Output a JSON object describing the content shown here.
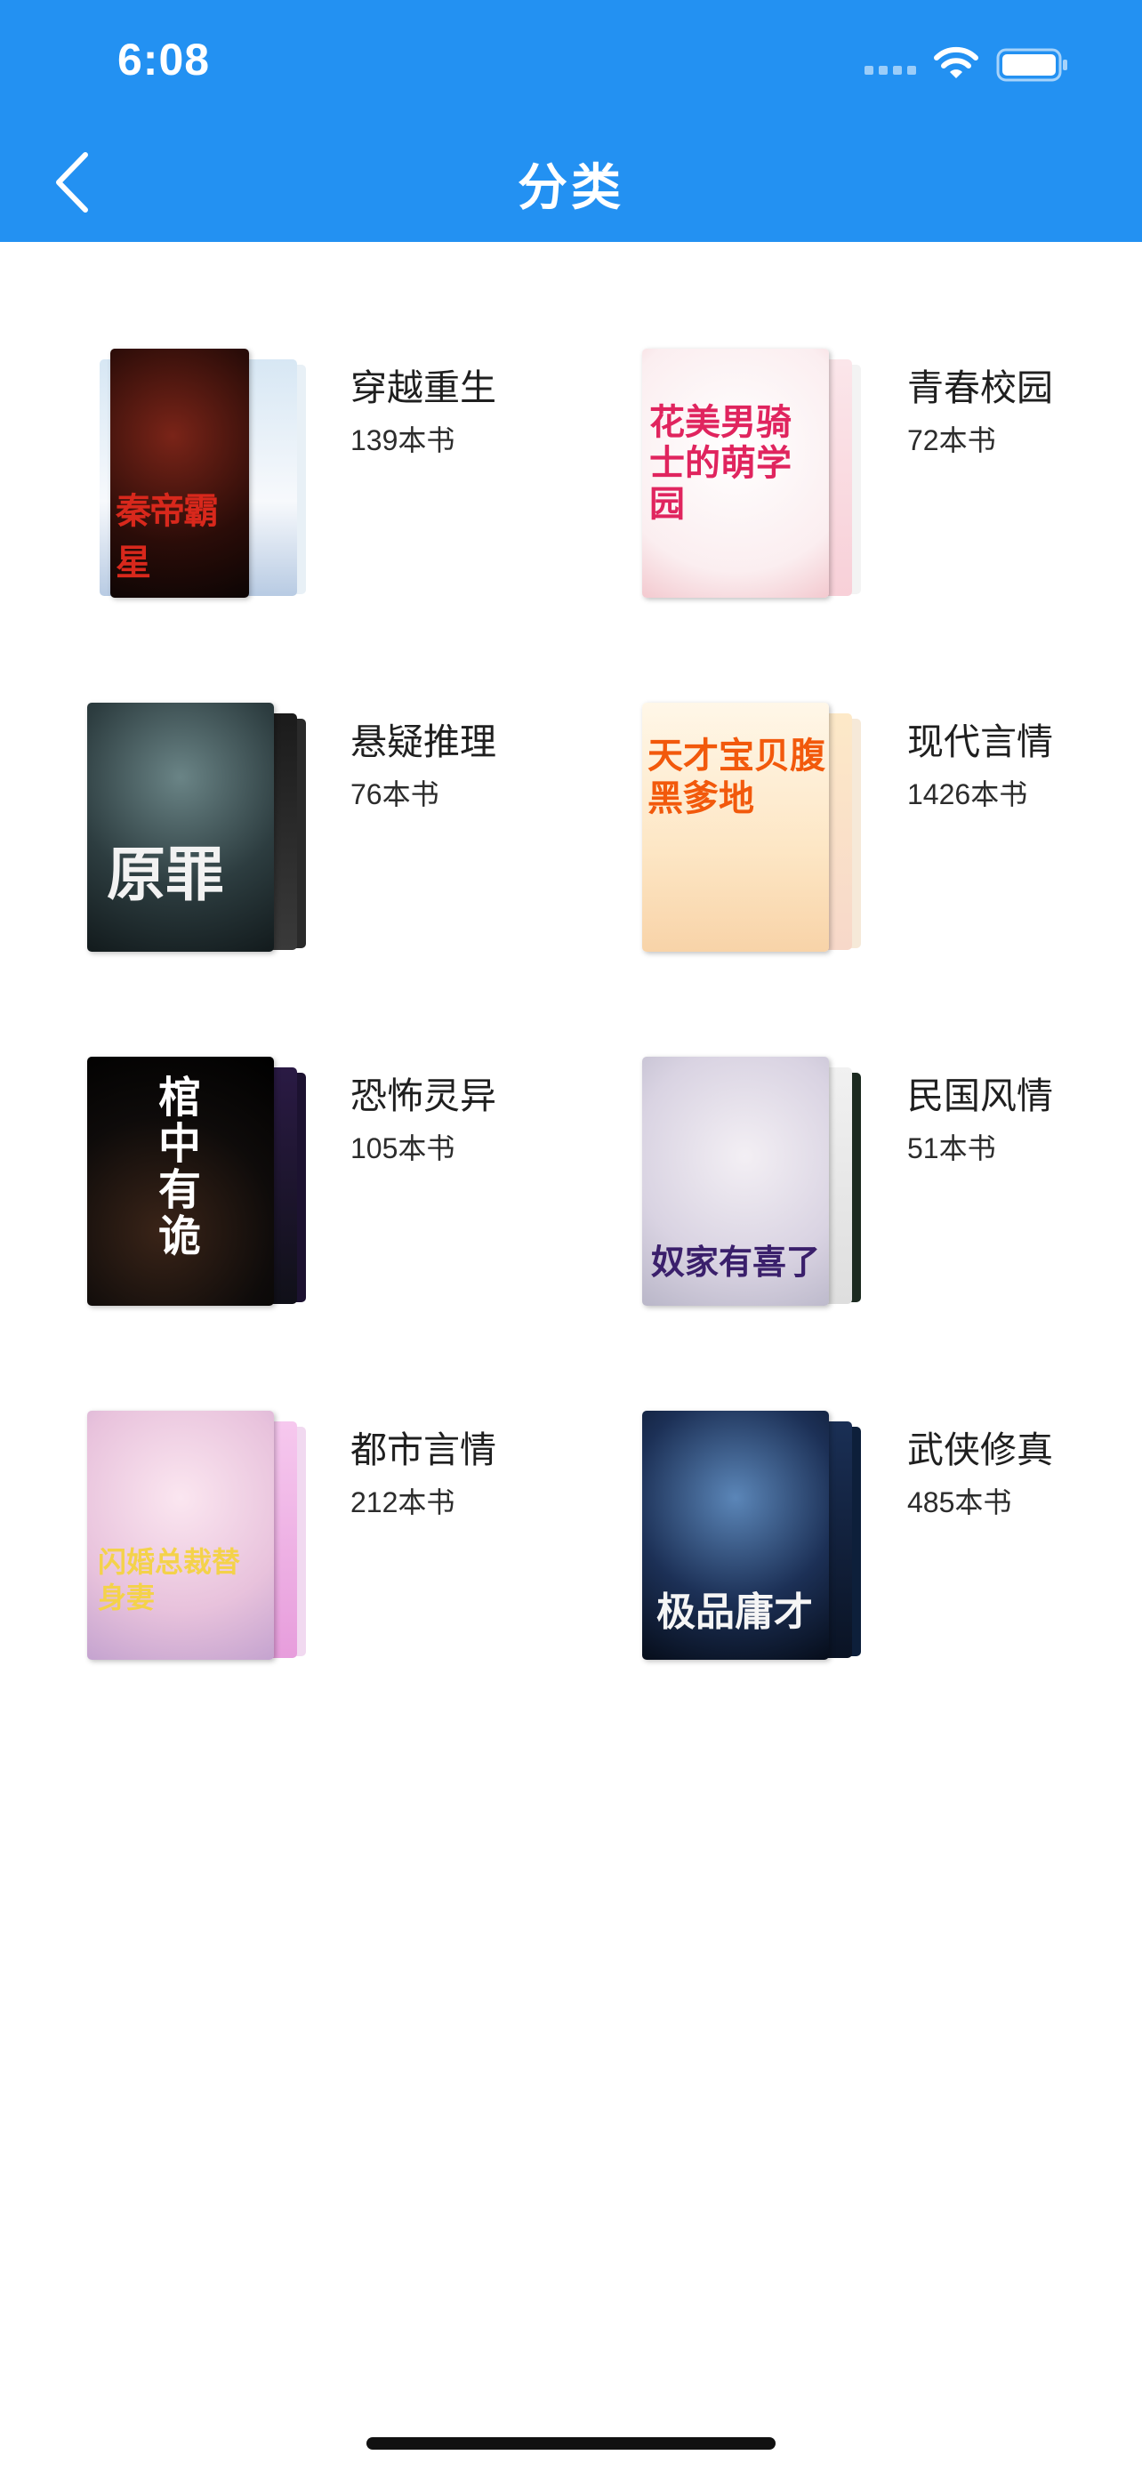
{
  "status_bar": {
    "time": "6:08"
  },
  "header": {
    "title": "分类",
    "back_icon": "chevron-left-icon",
    "background": "#2391f2"
  },
  "categories": [
    {
      "name": "穿越重生",
      "count": "139本书",
      "cover_text": "秦帝霸星"
    },
    {
      "name": "青春校园",
      "count": "72本书",
      "cover_text": "花美男骑士的萌学园"
    },
    {
      "name": "悬疑推理",
      "count": "76本书",
      "cover_text": "原罪"
    },
    {
      "name": "现代言情",
      "count": "1426本书",
      "cover_text": "天才宝贝腹黑爹地"
    },
    {
      "name": "恐怖灵异",
      "count": "105本书",
      "cover_text": "棺中有诡"
    },
    {
      "name": "民国风情",
      "count": "51本书",
      "cover_text": "奴家有喜了"
    },
    {
      "name": "都市言情",
      "count": "212本书",
      "cover_text": "闪婚总裁替身妻"
    },
    {
      "name": "武侠修真",
      "count": "485本书",
      "cover_text": "极品庸才"
    }
  ]
}
